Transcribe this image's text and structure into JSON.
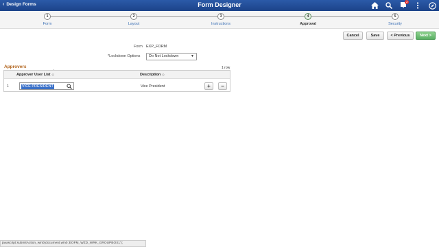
{
  "header": {
    "back_label": "Design Forms",
    "title": "Form Designer",
    "notification_count": "2",
    "icons": [
      "home-icon",
      "search-icon",
      "notifications-icon",
      "actions-menu-icon",
      "navbar-icon"
    ]
  },
  "steps": [
    {
      "num": "1",
      "label": "Form"
    },
    {
      "num": "2",
      "label": "Layout"
    },
    {
      "num": "3",
      "label": "Instructions"
    },
    {
      "num": "4",
      "label": "Approval",
      "active": true
    },
    {
      "num": "5",
      "label": "Security"
    }
  ],
  "actions": {
    "cancel": "Cancel",
    "save": "Save",
    "previous": "< Previous",
    "next": "Next >"
  },
  "form": {
    "form_label": "Form",
    "form_value": "EXP_FORM",
    "lockdown_label": "*Lockdown Options",
    "lockdown_value": "Do Not Lockdown"
  },
  "approvers": {
    "section_title": "Approvers",
    "row_count": "1 row",
    "col_user_list": "Approver User List",
    "col_description": "Description",
    "rows": [
      {
        "num": "1",
        "user_list": "VICE PRESIDENT",
        "description": "Vice President"
      }
    ]
  },
  "status_bar": "javascript:submitAction_win0(document.win0,'EOFM_WZD_WRK_GROUPBOX1');",
  "colors": {
    "header_blue": "#1c4389",
    "section_orange": "#b1631b",
    "next_green": "#5aaf64",
    "selection_blue": "#3a70c8"
  }
}
